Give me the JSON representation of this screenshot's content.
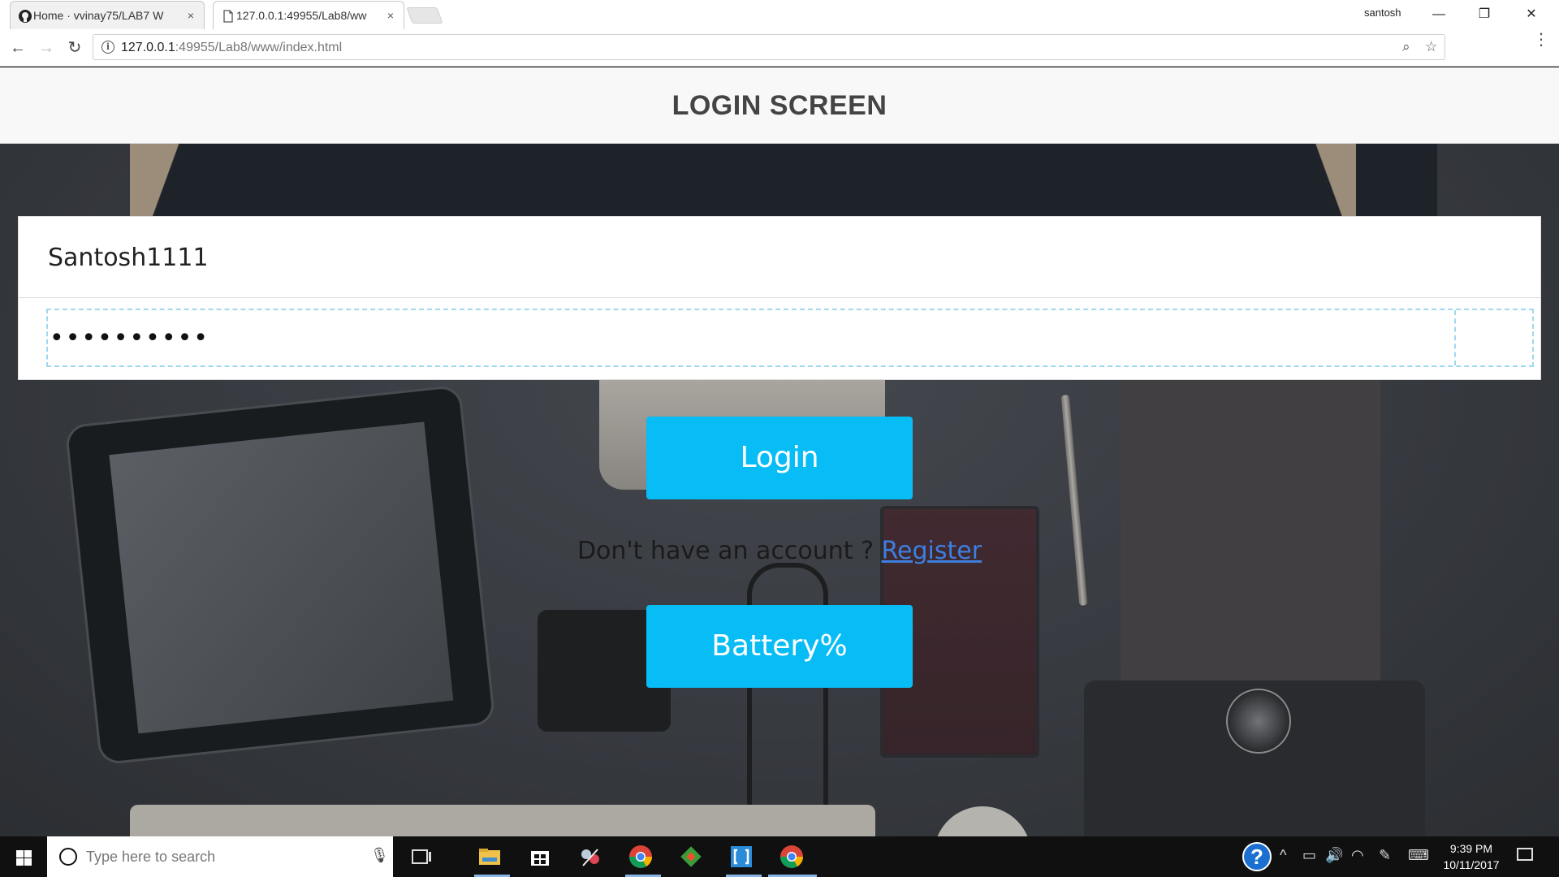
{
  "browser": {
    "tabs": [
      {
        "title": "Home · vvinay75/LAB7 W",
        "icon": "github-icon",
        "close": "×"
      },
      {
        "title": "127.0.0.1:49955/Lab8/ww",
        "icon": "document-icon",
        "close": "×"
      }
    ],
    "user_name": "santosh",
    "window_controls": {
      "minimize": "—",
      "restore": "❐",
      "close": "✕"
    },
    "nav": {
      "back": "←",
      "forward": "→",
      "reload": "↻"
    },
    "url_host": "127.0.0.1",
    "url_rest": ":49955/Lab8/www/index.html",
    "zoom_icon": "⌕",
    "star_icon": "☆",
    "menu_icon": "⋮"
  },
  "page": {
    "header_title": "LOGIN SCREEN",
    "username_value": "Santosh1111",
    "password_value": "••••••••••",
    "login_label": "Login",
    "register_prompt": "Don't have an account ? ",
    "register_link": "Register",
    "battery_label": "Battery%",
    "accent_color": "#08bcf6"
  },
  "taskbar": {
    "search_placeholder": "Type here to search",
    "mic_icon": "🎙",
    "time": "9:39 PM",
    "date": "10/11/2017",
    "help_glyph": "?",
    "tray": {
      "chevron": "^",
      "battery": "▭",
      "volume": "🔊",
      "wifi": "◠",
      "pen": "✎",
      "keyboard": "⌨"
    }
  }
}
